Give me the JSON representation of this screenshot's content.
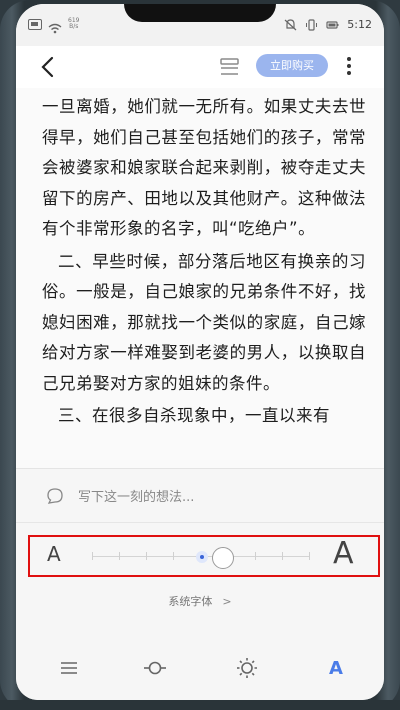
{
  "status_bar": {
    "network_speed": "619\nB/s",
    "time": "5:12"
  },
  "nav": {
    "buy_label": "立即购买"
  },
  "content": {
    "paragraphs": [
      "一旦离婚，她们就一无所有。如果丈夫去世得早，她们自己甚至包括她们的孩子，常常会被婆家和娘家联合起来剥削，被夺走丈夫留下的房产、田地以及其他财产。这种做法有个非常形象的名字，叫“吃绝户”。",
      "二、早些时候，部分落后地区有换亲的习俗。一般是，自己娘家的兄弟条件不好，找媳妇困难，那就找一个类似的家庭，自己嫁给对方家一样难娶到老婆的男人，以换取自己兄弟娶对方家的姐妹的条件。",
      "三、在很多自杀现象中，一直以来有"
    ]
  },
  "panel": {
    "comment_placeholder": "写下这一刻的想法...",
    "font_small_label": "A",
    "font_large_label": "A",
    "font_size_level": 0.5,
    "system_font_label": "系统字体",
    "system_font_chevron": ">",
    "toolbar_font_label": "A"
  },
  "colors": {
    "accent": "#4a7ce8",
    "buy_button": "#9bb5ee",
    "highlight_box": "#e01010"
  }
}
